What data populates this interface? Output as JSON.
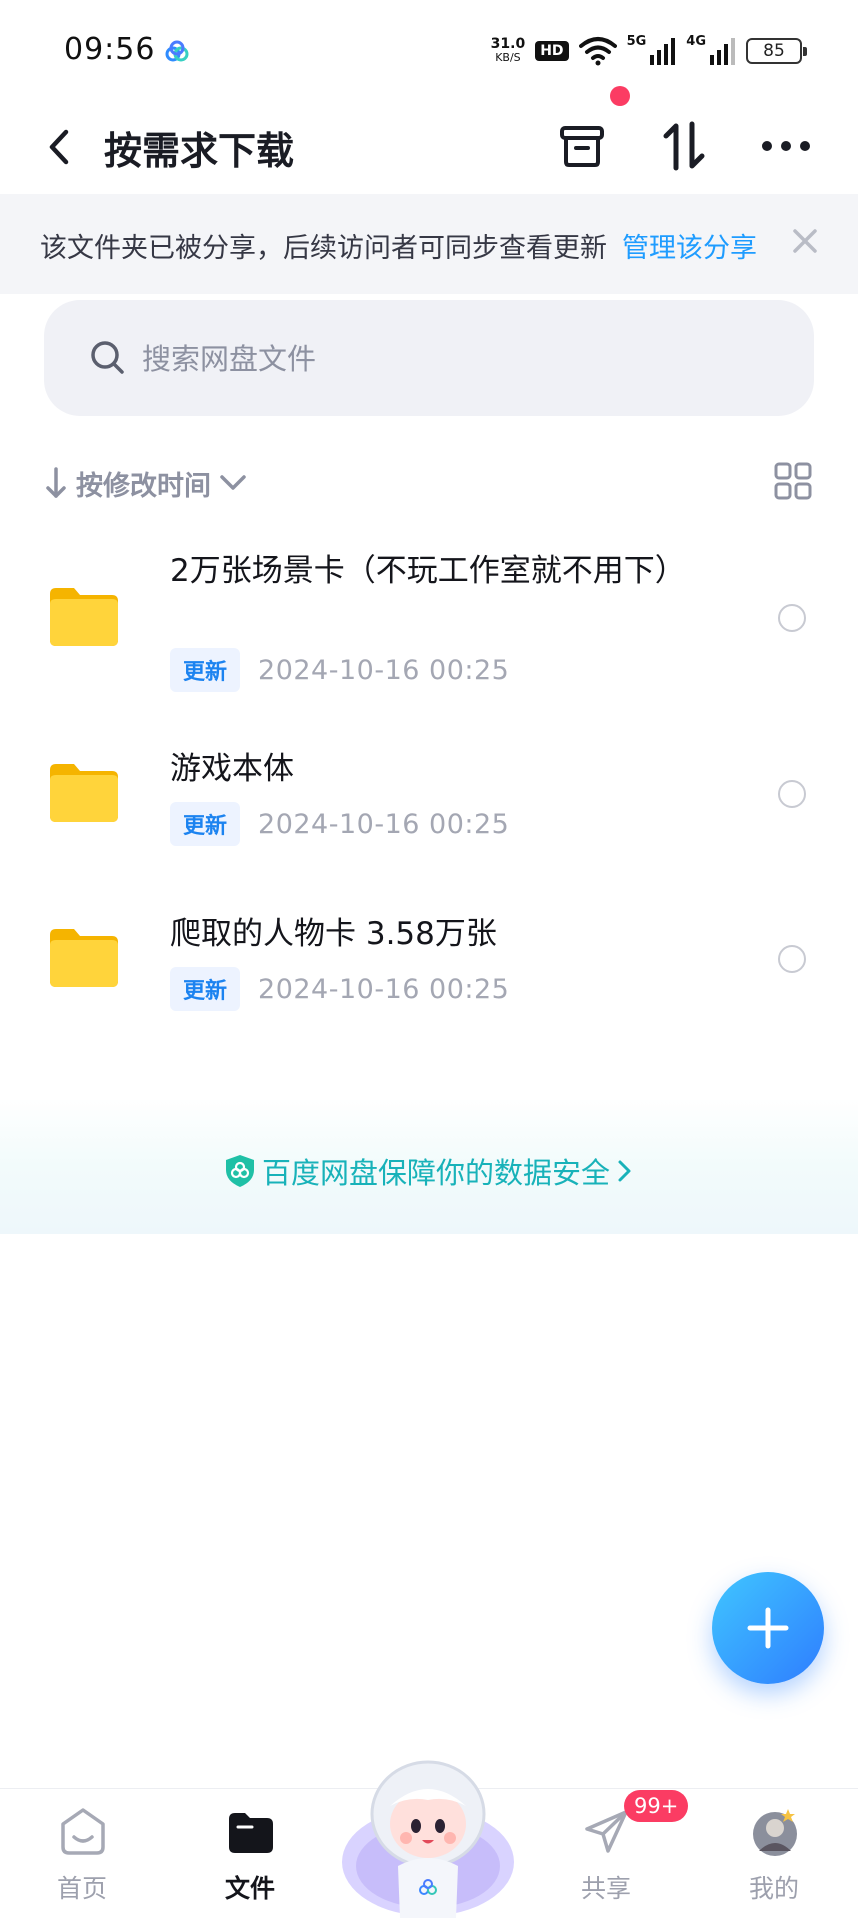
{
  "status_bar": {
    "time": "09:56",
    "speed_value": "31.0",
    "speed_unit": "KB/S",
    "hd_label": "HD",
    "net_5g": "5G",
    "net_4g": "4G",
    "battery": "85"
  },
  "header": {
    "title": "按需求下载",
    "icons": [
      "back-arrow-icon",
      "archive-box-icon",
      "transfer-icon",
      "more-icon"
    ]
  },
  "share_banner": {
    "text": "该文件夹已被分享，后续访问者可同步查看更新",
    "link": "管理该分享",
    "close": "×"
  },
  "search": {
    "placeholder": "搜索网盘文件",
    "value": ""
  },
  "sort": {
    "label": "按修改时间"
  },
  "files": [
    {
      "name": "2万张场景卡（不玩工作室就不用下）",
      "badge": "更新",
      "date": "2024-10-16  00:25"
    },
    {
      "name": "游戏本体",
      "badge": "更新",
      "date": "2024-10-16  00:25"
    },
    {
      "name": "爬取的人物卡 3.58万张",
      "badge": "更新",
      "date": "2024-10-16  00:25"
    }
  ],
  "security_banner": {
    "text": "百度网盘保障你的数据安全"
  },
  "tabs": [
    {
      "label": "首页",
      "active": false
    },
    {
      "label": "文件",
      "active": true
    },
    {
      "label": "共享",
      "active": false,
      "badge": "99+"
    },
    {
      "label": "我的",
      "active": false
    }
  ],
  "colors": {
    "accent": "#1e9cff",
    "badge_red": "#fb3c63",
    "folder_yellow": "#ffcb2f",
    "security_teal": "#18b2b9"
  }
}
